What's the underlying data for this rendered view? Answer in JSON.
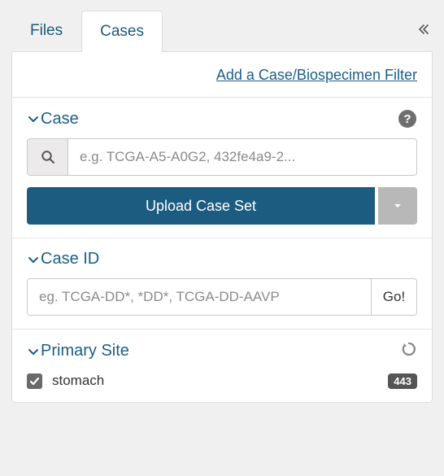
{
  "tabs": {
    "files": "Files",
    "cases": "Cases"
  },
  "add_filter_link": "Add a Case/Biospecimen Filter",
  "case_section": {
    "title": "Case",
    "search_placeholder": "e.g. TCGA-A5-A0G2, 432fe4a9-2...",
    "upload_label": "Upload Case Set"
  },
  "caseid_section": {
    "title": "Case ID",
    "placeholder": "eg. TCGA-DD*, *DD*, TCGA-DD-AAVP",
    "go_label": "Go!"
  },
  "primary_site": {
    "title": "Primary Site",
    "items": [
      {
        "label": "stomach",
        "count": "443",
        "checked": true
      }
    ]
  }
}
